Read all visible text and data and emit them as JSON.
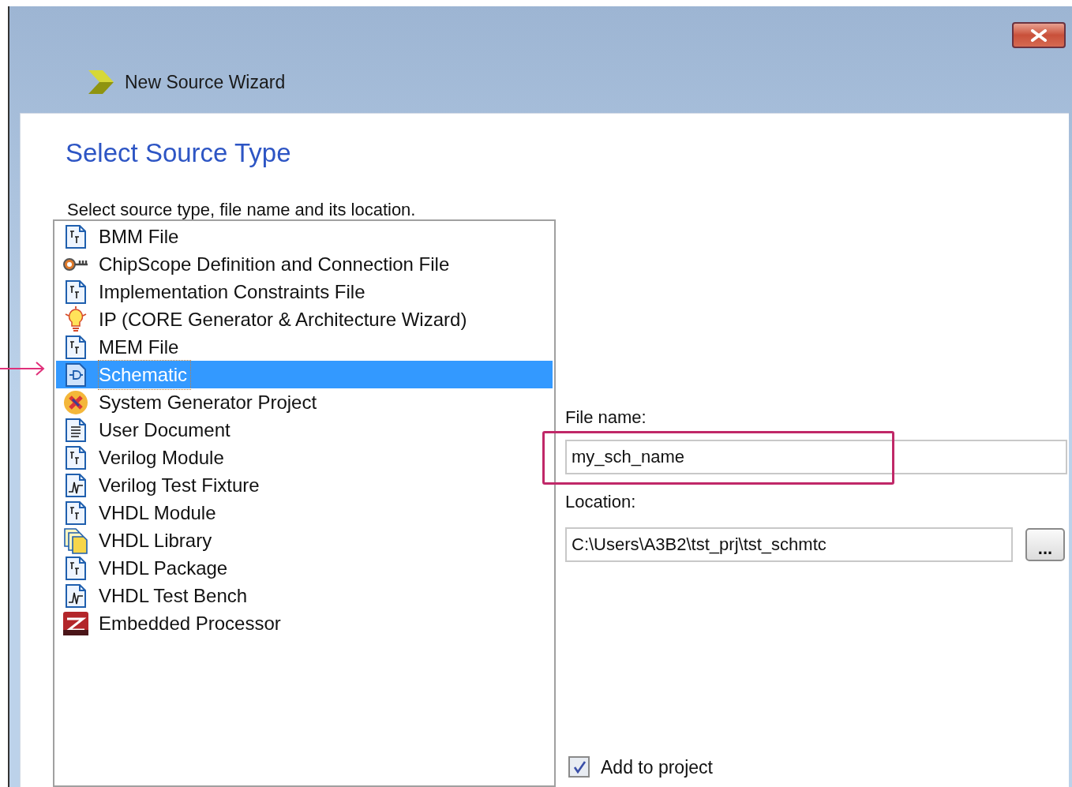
{
  "window": {
    "title": "New Source Wizard"
  },
  "page": {
    "heading": "Select Source Type",
    "instruction": "Select source type, file name and its location."
  },
  "source_types": [
    {
      "label": "BMM File",
      "kind": "document",
      "selected": false
    },
    {
      "label": "ChipScope Definition and Connection File",
      "kind": "key",
      "selected": false
    },
    {
      "label": "Implementation Constraints File",
      "kind": "document",
      "selected": false
    },
    {
      "label": "IP (CORE Generator & Architecture Wizard)",
      "kind": "bulb",
      "selected": false
    },
    {
      "label": "MEM File",
      "kind": "document",
      "selected": false
    },
    {
      "label": "Schematic",
      "kind": "gate",
      "selected": true
    },
    {
      "label": "System Generator Project",
      "kind": "badge",
      "selected": false
    },
    {
      "label": "User Document",
      "kind": "text",
      "selected": false
    },
    {
      "label": "Verilog Module",
      "kind": "document",
      "selected": false
    },
    {
      "label": "Verilog Test Fixture",
      "kind": "wave",
      "selected": false
    },
    {
      "label": "VHDL Module",
      "kind": "document",
      "selected": false
    },
    {
      "label": "VHDL Library",
      "kind": "stack",
      "selected": false
    },
    {
      "label": "VHDL Package",
      "kind": "document",
      "selected": false
    },
    {
      "label": "VHDL Test Bench",
      "kind": "wave",
      "selected": false
    },
    {
      "label": "Embedded Processor",
      "kind": "chip",
      "selected": false
    }
  ],
  "file_name": {
    "label": "File name:",
    "value": "my_sch_name",
    "highlighted": true
  },
  "location": {
    "label": "Location:",
    "value": "C:\\Users\\A3B2\\tst_prj\\tst_schmtc",
    "browse": "..."
  },
  "add_to_project": {
    "label": "Add to project",
    "checked": true
  },
  "annotation_arrow": true
}
